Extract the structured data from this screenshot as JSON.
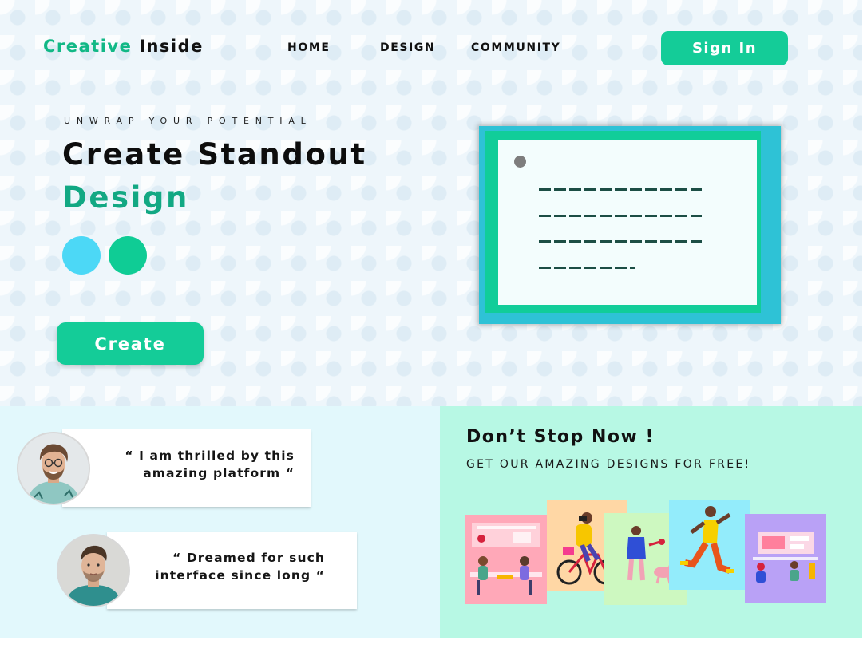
{
  "brand": {
    "name_part1": "Creative",
    "name_part2": "Inside",
    "accent_color": "#12b886"
  },
  "nav": {
    "items": [
      {
        "label": "HOME"
      },
      {
        "label": "DESIGN"
      },
      {
        "label": "COMMUNITY"
      }
    ],
    "signin_label": "Sign In"
  },
  "hero": {
    "tagline": "UNWRAP YOUR POTENTIAL",
    "headline_line1": "Create Standout",
    "headline_line2": "Design",
    "swatches": [
      {
        "name": "blue",
        "color": "#4cd8f6"
      },
      {
        "name": "green",
        "color": "#0fcc95"
      }
    ],
    "cta_label": "Create"
  },
  "testimonials": [
    {
      "line1": "“ I am thrilled by this",
      "line2": "amazing platform “"
    },
    {
      "line1": "“ Dreamed for such",
      "line2": "interface since long “"
    }
  ],
  "promo": {
    "title": "Don’t Stop Now !",
    "subtitle": "GET OUR AMAZING DESIGNS FOR FREE!",
    "tiles": [
      {
        "icon": "people-at-table-illustration",
        "color": "#ffa8b8"
      },
      {
        "icon": "cyclist-illustration",
        "color": "#ffd7a5"
      },
      {
        "icon": "woman-with-dog-illustration",
        "color": "#cdf8c0"
      },
      {
        "icon": "runner-illustration",
        "color": "#93ecfb"
      },
      {
        "icon": "workspace-illustration",
        "color": "#b9a1f6"
      }
    ]
  }
}
